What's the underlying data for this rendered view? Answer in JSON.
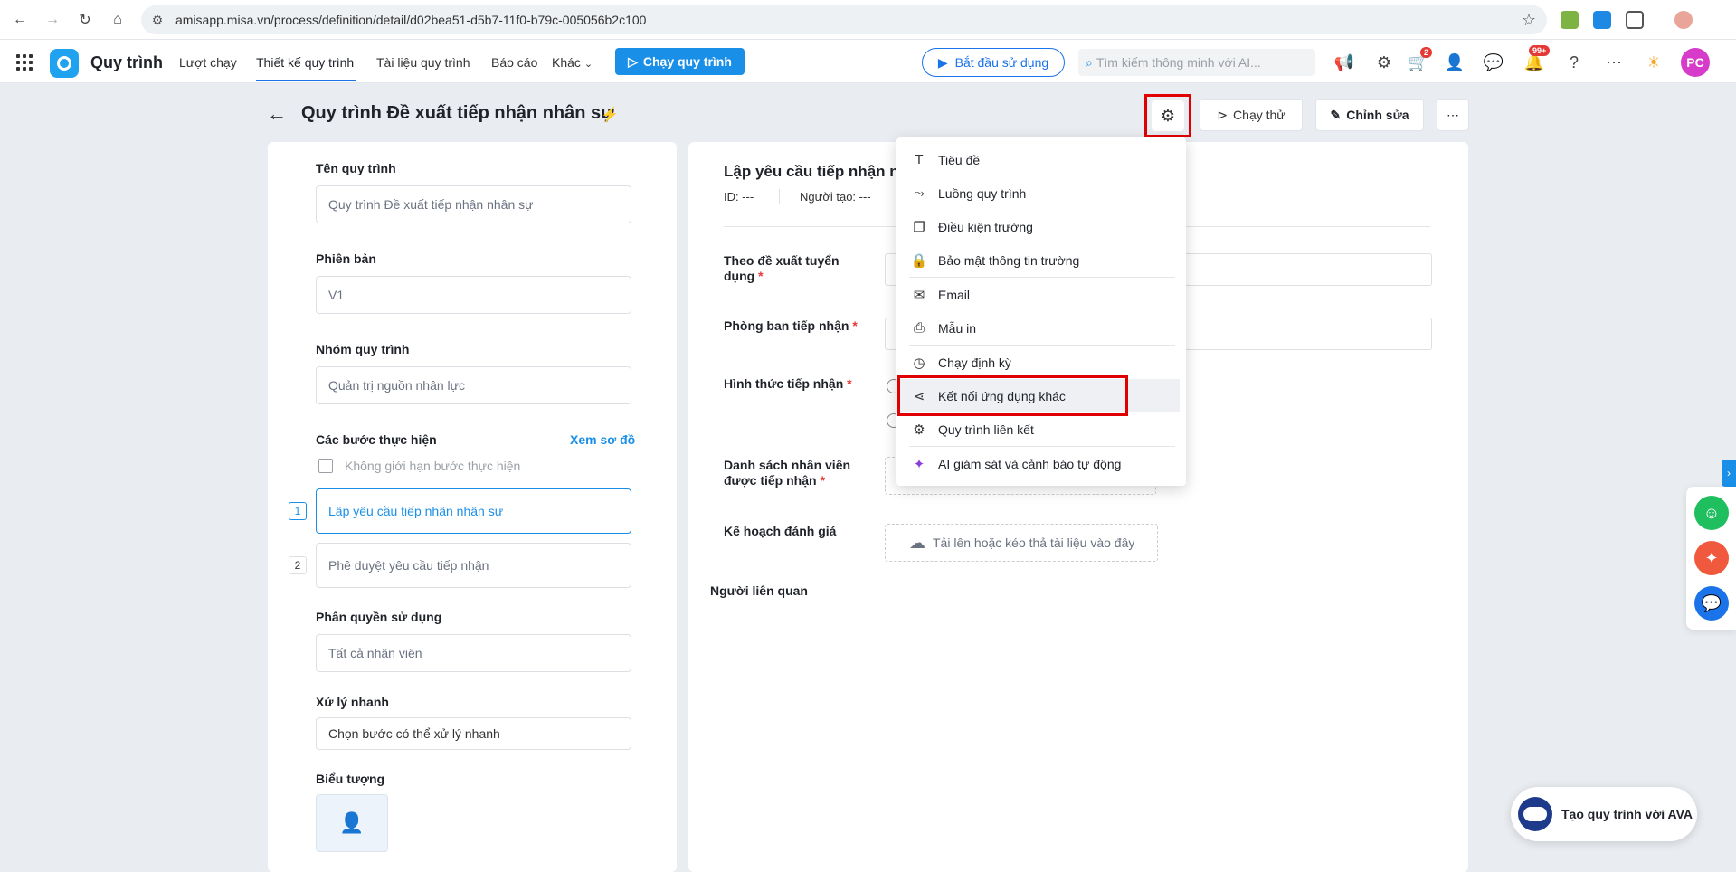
{
  "browser": {
    "url": "amisapp.misa.vn/process/definition/detail/d02bea51-d5b7-11f0-b79c-005056b2c100"
  },
  "header": {
    "app_title": "Quy trình",
    "nav": [
      "Lượt chạy",
      "Thiết kế quy trình",
      "Tài liệu quy trình",
      "Báo cáo",
      "Khác"
    ],
    "run_button": "Chạy quy trình",
    "start_button": "Bắt đầu sử dụng",
    "search_placeholder": "Tìm kiếm thông minh với AI...",
    "cart_badge": "2",
    "bell_badge": "99+",
    "avatar_initials": "PC"
  },
  "page": {
    "title": "Quy trình Đề xuất tiếp nhận nhân sự",
    "test_run_button": "Chạy thử",
    "edit_button": "Chỉnh sửa"
  },
  "left_panel": {
    "name_label": "Tên quy trình",
    "name_value": "Quy trình Đề xuất tiếp nhận nhân sự",
    "version_label": "Phiên bản",
    "version_value": "V1",
    "group_label": "Nhóm quy trình",
    "group_value": "Quản trị nguồn nhân lực",
    "steps_label": "Các bước thực hiện",
    "view_diagram": "Xem sơ đồ",
    "unlimited_steps": "Không giới hạn bước thực hiện",
    "steps": [
      {
        "num": "1",
        "label": "Lập yêu cầu tiếp nhận nhân sự"
      },
      {
        "num": "2",
        "label": "Phê duyệt yêu cầu tiếp nhận"
      }
    ],
    "permission_label": "Phân quyền sử dụng",
    "permission_value": "Tất cả nhân viên",
    "quick_label": "Xử lý nhanh",
    "quick_value": "Chọn bước có thể xử lý nhanh",
    "icon_label": "Biểu tượng"
  },
  "right_panel": {
    "form_title": "Lập yêu cầu tiếp nhận n",
    "id_text": "ID: ---",
    "creator_text": "Người tạo: ---",
    "fields": [
      {
        "label_line1": "Theo đề xuất tuyển",
        "label_line2": "dụng"
      },
      {
        "label_line1": "Phòng ban tiếp nhận",
        "label_line2": ""
      },
      {
        "label_line1": "Hình thức tiếp nhận",
        "label_line2": ""
      },
      {
        "label_line1": "Danh sách nhân viên",
        "label_line2": "được tiếp nhận"
      },
      {
        "label_line1": "Kế hoạch đánh giá",
        "label_line2": ""
      }
    ],
    "required_mark": "*",
    "upload_text": "Tải lên hoặc kéo thả tài liệu vào đây",
    "related_label": "Người liên quan"
  },
  "menu": {
    "items": [
      {
        "label": "Tiêu đề",
        "icon": "text-icon"
      },
      {
        "label": "Luồng quy trình",
        "icon": "flow-icon"
      },
      {
        "label": "Điều kiện trường",
        "icon": "copy-icon"
      },
      {
        "label": "Bảo mật thông tin trường",
        "icon": "lock-icon"
      },
      {
        "label": "Email",
        "icon": "mail-icon"
      },
      {
        "label": "Mẫu in",
        "icon": "printer-icon"
      },
      {
        "label": "Chạy định kỳ",
        "icon": "clock-icon"
      },
      {
        "label": "Kết nối ứng dụng khác",
        "icon": "share-icon"
      },
      {
        "label": "Quy trình liên kết",
        "icon": "gear-link-icon"
      },
      {
        "label": "AI giám sát và cảnh báo tự động",
        "icon": "sparkle-icon"
      }
    ]
  },
  "widgets": {
    "ava_button": "Tạo quy trình với AVA"
  },
  "colors": {
    "accent": "#1a8fe8",
    "highlight": "#e00000",
    "avatar": "#d63cc9"
  }
}
